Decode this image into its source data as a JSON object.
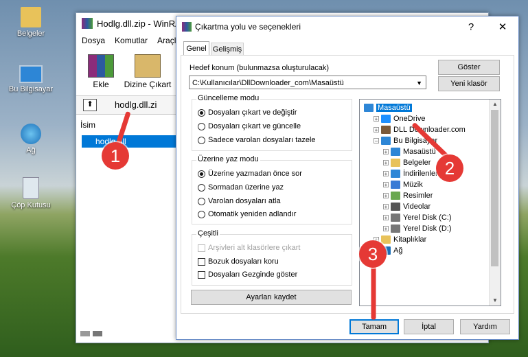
{
  "desktop": {
    "icons": [
      "Belgeler",
      "Bu Bilgisayar",
      "Ağ",
      "Çöp Kutusu"
    ]
  },
  "winrar": {
    "title": "Hodlg.dll.zip - WinRA",
    "menu": [
      "Dosya",
      "Komutlar",
      "Araçla"
    ],
    "toolbar": {
      "add_label": "Ekle",
      "extract_label": "Dizine Çıkart"
    },
    "path": "hodlg.dll.zi",
    "column_name": "İsim",
    "file": "hodlg.dll"
  },
  "dialog": {
    "title": "Çıkartma yolu ve seçenekleri",
    "help": "?",
    "close": "✕",
    "tabs": [
      "Genel",
      "Gelişmiş"
    ],
    "dest_label": "Hedef konum (bulunmazsa oluşturulacak)",
    "dest_value": "C:\\Kullanıcılar\\DllDownloader_com\\Masaüstü",
    "show_button": "Göster",
    "new_folder_button": "Yeni klasör",
    "update_group": {
      "title": "Güncelleme modu",
      "options": [
        "Dosyaları çıkart ve değiştir",
        "Dosyaları çıkart ve güncelle",
        "Sadece varolan dosyaları tazele"
      ],
      "selected": 0
    },
    "overwrite_group": {
      "title": "Üzerine yaz modu",
      "options": [
        "Üzerine yazmadan önce sor",
        "Sormadan üzerine yaz",
        "Varolan dosyaları atla",
        "Otomatik yeniden adlandır"
      ],
      "selected": 0
    },
    "misc_group": {
      "title": "Çeşitli",
      "options": [
        "Arşivleri alt klasörlere çıkart",
        "Bozuk dosyaları koru",
        "Dosyaları Gezginde göster"
      ],
      "disabled": [
        true,
        false,
        false
      ]
    },
    "save_settings_button": "Ayarları kaydet",
    "tree": [
      {
        "label": "Masaüstü",
        "level": 0,
        "selected": true
      },
      {
        "label": "OneDrive",
        "level": 1
      },
      {
        "label": "DLL Downloader.com",
        "level": 1
      },
      {
        "label": "Bu Bilgisayar",
        "level": 1
      },
      {
        "label": "Masaüstü",
        "level": 2
      },
      {
        "label": "Belgeler",
        "level": 2
      },
      {
        "label": "İndirilenler",
        "level": 2
      },
      {
        "label": "Müzik",
        "level": 2
      },
      {
        "label": "Resimler",
        "level": 2
      },
      {
        "label": "Videolar",
        "level": 2
      },
      {
        "label": "Yerel Disk (C:)",
        "level": 2
      },
      {
        "label": "Yerel Disk (D:)",
        "level": 2
      },
      {
        "label": "Kitaplıklar",
        "level": 1
      },
      {
        "label": "Ağ",
        "level": 1
      }
    ],
    "ok_button": "Tamam",
    "cancel_button": "İptal",
    "help_button": "Yardım"
  },
  "annotations": [
    "1",
    "2",
    "3"
  ],
  "colors": {
    "accent": "#0078d7",
    "annotation": "#e53935"
  }
}
